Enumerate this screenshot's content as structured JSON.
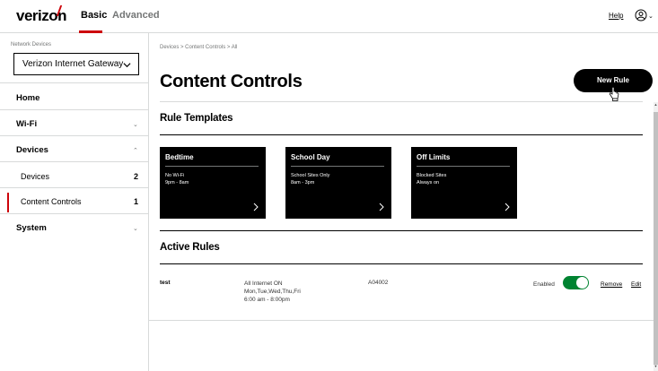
{
  "header": {
    "logo": "verizon",
    "tabs": [
      {
        "label": "Basic",
        "active": true
      },
      {
        "label": "Advanced",
        "active": false
      }
    ],
    "help": "Help",
    "brand_red": "#cd040b"
  },
  "sidebar": {
    "network_devices_label": "Network Devices",
    "selected_device": "Verizon Internet Gateway",
    "items": [
      {
        "label": "Home"
      },
      {
        "label": "Wi-Fi",
        "expanded": false
      },
      {
        "label": "Devices",
        "expanded": true
      },
      {
        "label": "System",
        "expanded": false
      }
    ],
    "sub_items": [
      {
        "label": "Devices",
        "count": "2"
      },
      {
        "label": "Content Controls",
        "count": "1",
        "active": true
      }
    ]
  },
  "main": {
    "breadcrumb": "Devices  >  Content Controls  >  All",
    "title": "Content Controls",
    "new_rule_button": "New Rule",
    "rule_templates_title": "Rule Templates",
    "templates": [
      {
        "name": "Bedtime",
        "line1": "No Wi-Fi",
        "line2": "9pm - 8am"
      },
      {
        "name": "School Day",
        "line1": "School Sites Only",
        "line2": "8am - 3pm"
      },
      {
        "name": "Off Limits",
        "line1": "Blocked Sites",
        "line2": "Always on"
      }
    ],
    "active_rules_title": "Active Rules",
    "rules": [
      {
        "name": "test",
        "desc_line1": "All Internet ON",
        "desc_line2": "Mon,Tue,Wed,Thu,Fri",
        "desc_line3": "6:00 am - 8:00pm",
        "device": "A04002",
        "status": "Enabled",
        "enabled": true,
        "remove": "Remove",
        "edit": "Edit"
      }
    ],
    "toggle_color": "#008331"
  }
}
